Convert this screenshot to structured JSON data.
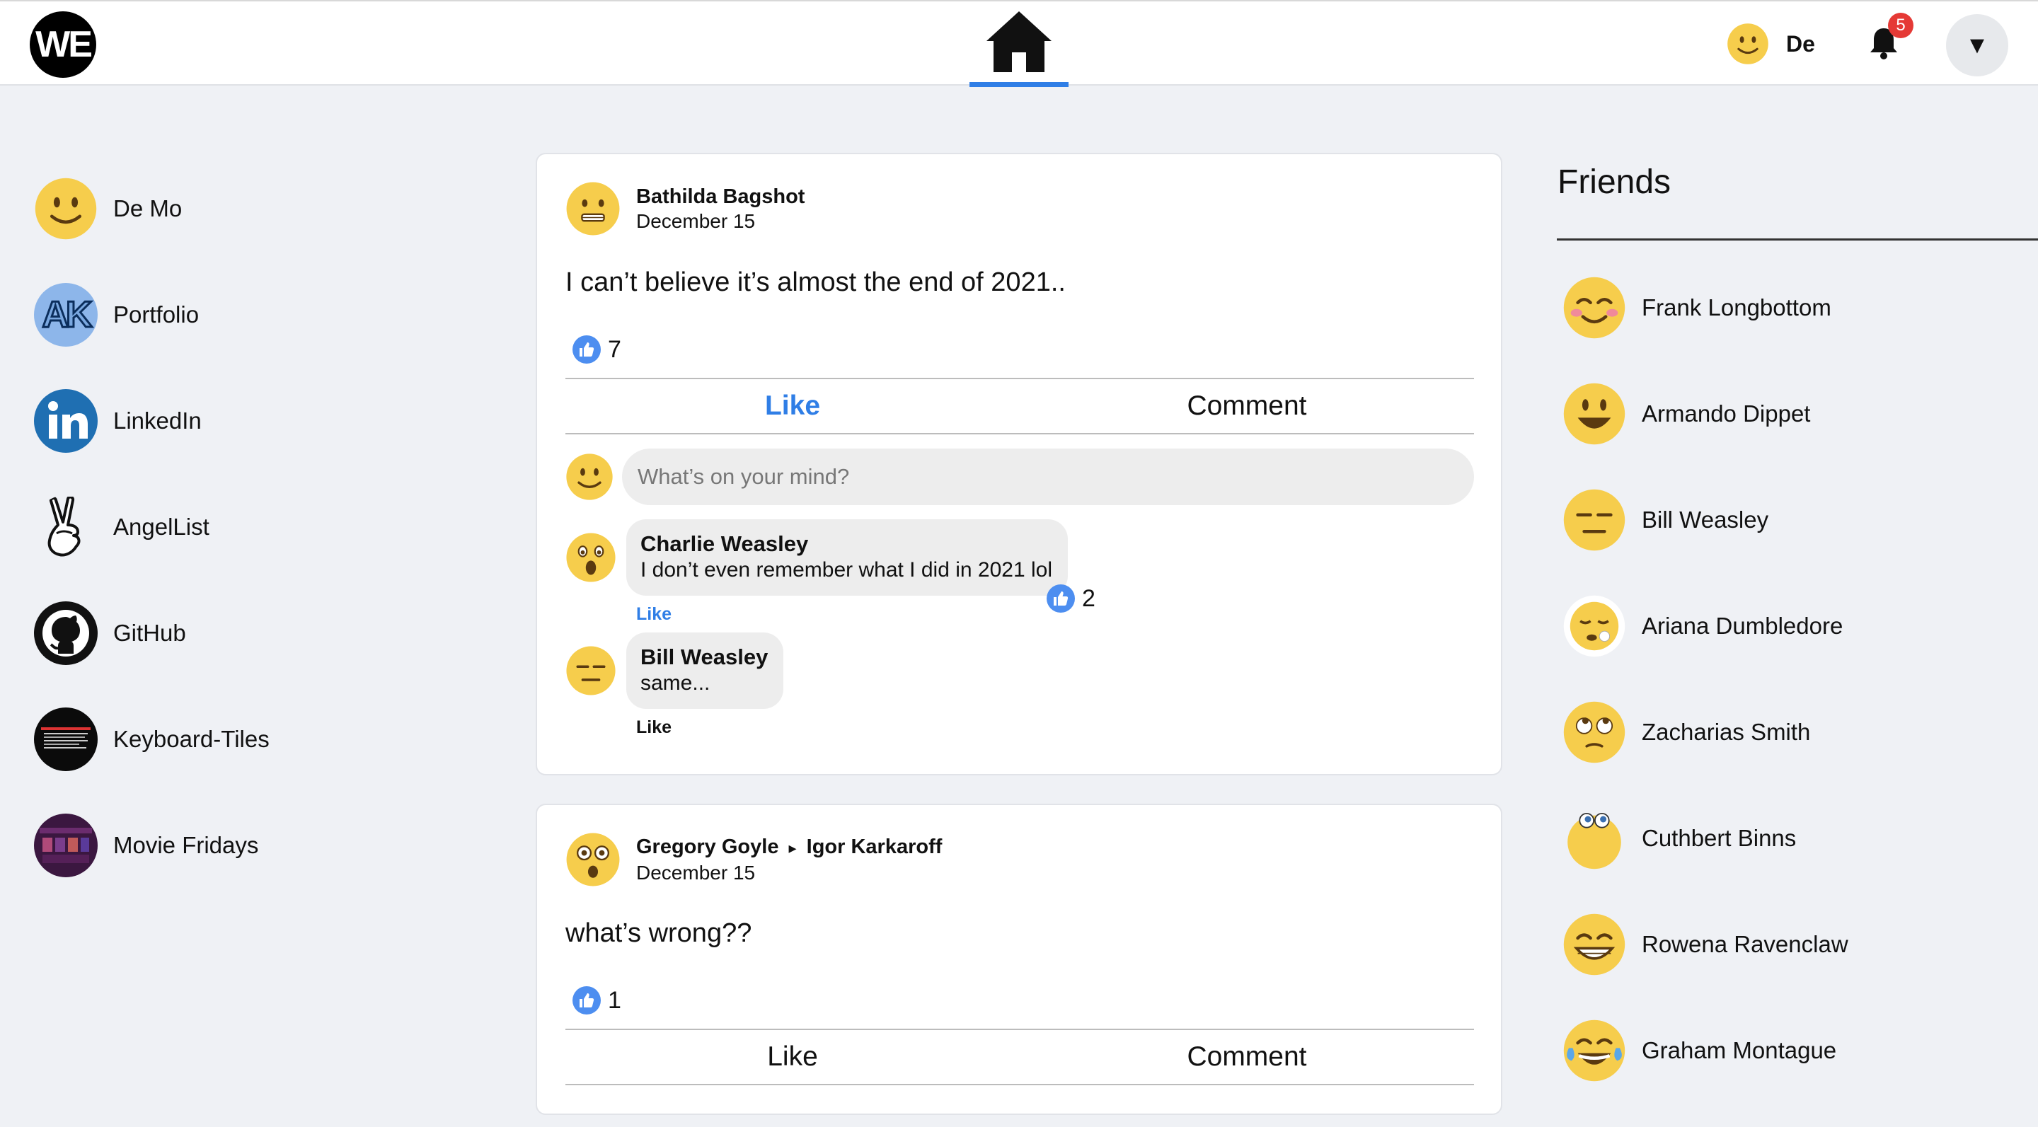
{
  "header": {
    "logo_text": "WE",
    "user_short_name": "De",
    "notification_count": "5",
    "menu_glyph": "▼"
  },
  "sidebar": {
    "items": [
      {
        "label": "De Mo",
        "icon": "smiley-avatar-icon"
      },
      {
        "label": "Portfolio",
        "icon": "ak-monogram-icon"
      },
      {
        "label": "LinkedIn",
        "icon": "linkedin-icon"
      },
      {
        "label": "AngelList",
        "icon": "peace-hand-icon"
      },
      {
        "label": "GitHub",
        "icon": "github-icon"
      },
      {
        "label": "Keyboard-Tiles",
        "icon": "keyboard-tiles-thumb-icon"
      },
      {
        "label": "Movie Fridays",
        "icon": "movie-fridays-thumb-icon"
      }
    ]
  },
  "posts": [
    {
      "author": "Bathilda Bagshot",
      "date": "December 15",
      "text": "I can’t believe it’s almost the end of 2021..",
      "likes": "7",
      "like_label": "Like",
      "comment_label": "Comment",
      "composer_placeholder": "What’s on your mind?",
      "comments": [
        {
          "author": "Charlie Weasley",
          "text": "I don’t even remember what I did in 2021 lol",
          "like_label": "Like",
          "likes": "2"
        },
        {
          "author": "Bill Weasley",
          "text": "same...",
          "like_label": "Like"
        }
      ]
    },
    {
      "author": "Gregory Goyle",
      "recipient": "Igor Karkaroff",
      "separator": "▸",
      "date": "December 15",
      "text": "what’s wrong??",
      "likes": "1",
      "like_label": "Like",
      "comment_label": "Comment"
    }
  ],
  "friends": {
    "title": "Friends",
    "items": [
      {
        "name": "Frank Longbottom"
      },
      {
        "name": "Armando Dippet"
      },
      {
        "name": "Bill Weasley"
      },
      {
        "name": "Ariana Dumbledore"
      },
      {
        "name": "Zacharias Smith"
      },
      {
        "name": "Cuthbert Binns"
      },
      {
        "name": "Rowena Ravenclaw"
      },
      {
        "name": "Graham Montague"
      }
    ]
  },
  "colors": {
    "accent": "#2f7ee6",
    "badge": "#e53935",
    "page_bg": "#eff1f5"
  }
}
